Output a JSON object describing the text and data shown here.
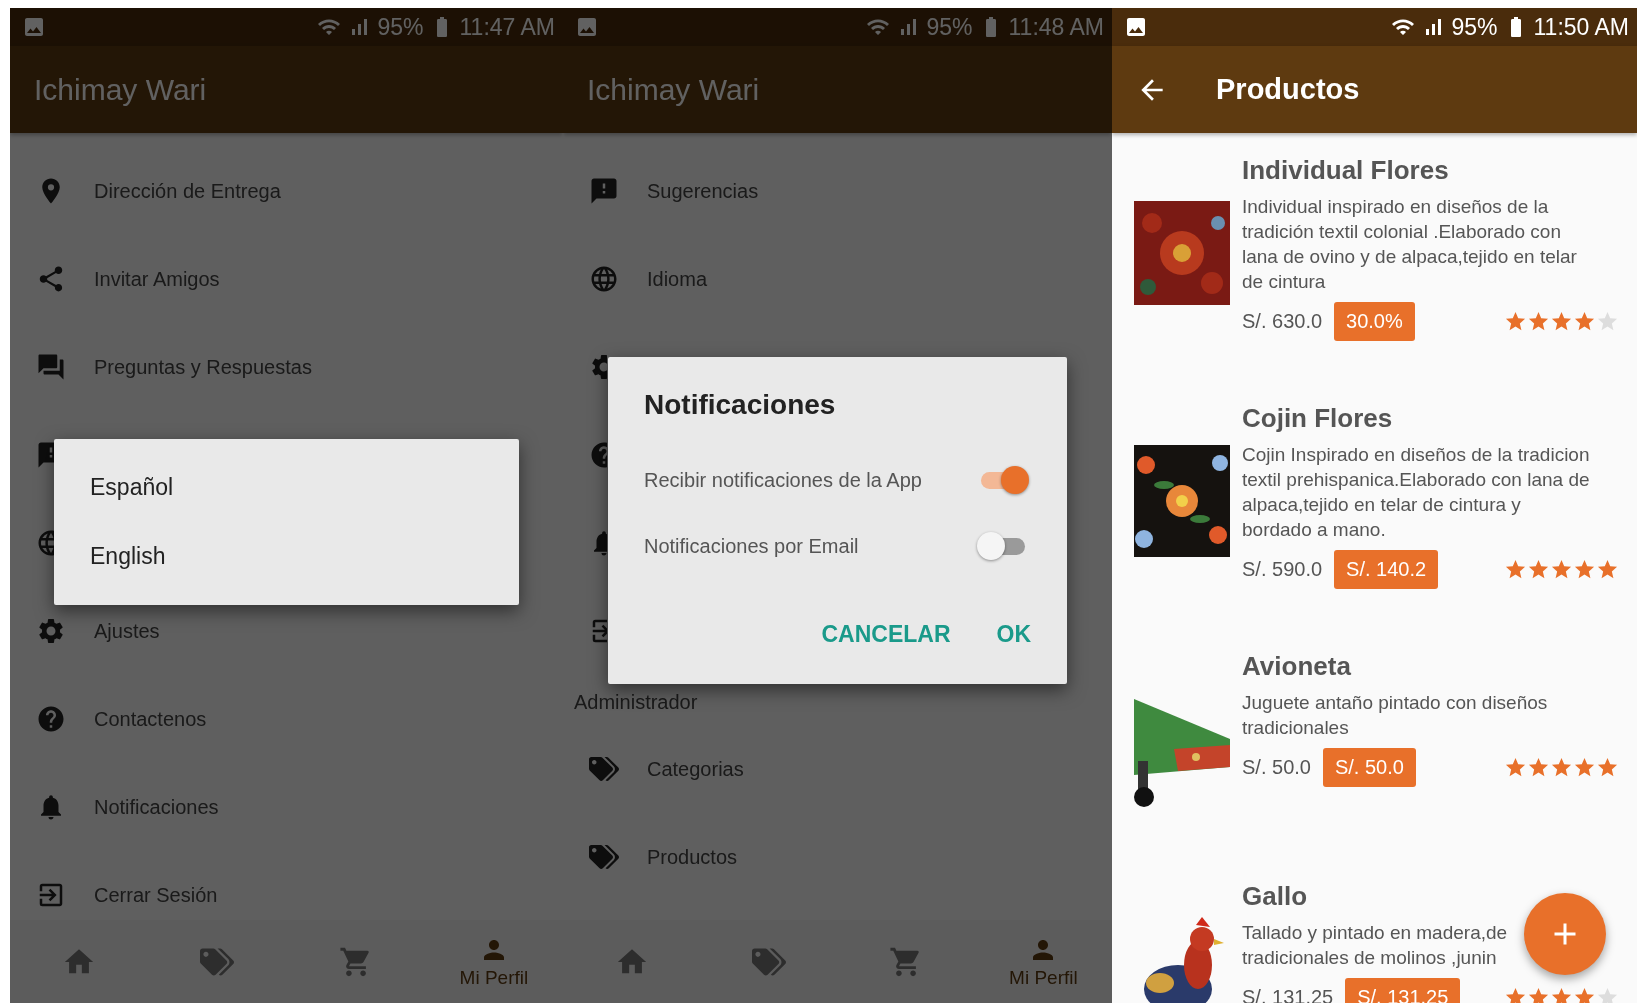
{
  "screens": [
    {
      "kind": "menu",
      "status_bar": {
        "battery": "95%",
        "time": "11:47 AM"
      },
      "app_bar": {
        "title": "Ichimay Wari"
      },
      "menu": [
        {
          "kind": "location",
          "label": "Dirección de Entrega"
        },
        {
          "kind": "share",
          "label": "Invitar Amigos"
        },
        {
          "kind": "faq",
          "label": "Preguntas y Respuestas"
        },
        {
          "kind": "feedback"
        },
        {
          "kind": "globe"
        },
        {
          "kind": "settings",
          "label": "Ajustes"
        },
        {
          "kind": "help",
          "label": "Contactenos"
        },
        {
          "kind": "bell",
          "label": "Notificaciones"
        },
        {
          "kind": "logout",
          "label": "Cerrar Sesión"
        }
      ],
      "bottom_nav": [
        {
          "kind": "home",
          "selected": false
        },
        {
          "kind": "tags",
          "selected": false
        },
        {
          "kind": "cart",
          "selected": false
        },
        {
          "kind": "person",
          "selected": true,
          "label": "Mi Perfil"
        }
      ],
      "dialog": {
        "kind": "choice",
        "options": [
          {
            "label": "Español"
          },
          {
            "label": "English"
          }
        ]
      }
    },
    {
      "kind": "menu",
      "status_bar": {
        "battery": "95%",
        "time": "11:48 AM"
      },
      "app_bar": {
        "title": "Ichimay Wari"
      },
      "menu": [
        {
          "kind": "feedback",
          "label": "Sugerencias"
        },
        {
          "kind": "globe",
          "label": "Idioma"
        },
        {
          "kind": "settings"
        },
        {
          "kind": "help"
        },
        {
          "kind": "bell"
        },
        {
          "kind": "logout"
        },
        {
          "kind": "section",
          "label": "Administrador"
        },
        {
          "kind": "tags",
          "label": "Categorias"
        },
        {
          "kind": "tags",
          "label": "Productos"
        }
      ],
      "bottom_nav": [
        {
          "kind": "home",
          "selected": false
        },
        {
          "kind": "tags",
          "selected": false
        },
        {
          "kind": "cart",
          "selected": false
        },
        {
          "kind": "person",
          "selected": true,
          "label": "Mi Perfil"
        }
      ],
      "dialog": {
        "kind": "switches",
        "title": "Notificaciones",
        "switches": [
          {
            "label": "Recibir notificaciones de la App",
            "on": true
          },
          {
            "label": "Notificaciones por Email",
            "on": false
          }
        ],
        "actions": [
          "CANCELAR",
          "OK"
        ]
      }
    },
    {
      "kind": "products",
      "status_bar": {
        "battery": "95%",
        "time": "11:50 AM"
      },
      "app_bar": {
        "title": "Productos"
      },
      "products": [
        {
          "name": "Individual Flores",
          "description": "Individual inspirado en diseños de la tradición textil colonial .Elaborado con lana de ovino y de alpaca,tejido en telar de cintura",
          "price": "S/. 630.0",
          "badge": "30.0%",
          "stars": 4
        },
        {
          "name": "Cojin Flores",
          "description": "Cojin Inspirado en diseños de la tradicion textil prehispanica.Elaborado con lana de alpaca,tejido en telar de cintura y bordado a mano.",
          "price": "S/. 590.0",
          "badge": "S/. 140.2",
          "stars": 5
        },
        {
          "name": "Avioneta",
          "description": "Juguete antaño pintado con diseños tradicionales",
          "price": "S/. 50.0",
          "badge": "S/. 50.0",
          "stars": 5
        },
        {
          "name": "Gallo",
          "description": "Tallado y pintado en madera,de tradicionales de molinos ,junin",
          "price": "S/. 131.25",
          "badge": "S/. 131.25",
          "stars": 4
        }
      ]
    }
  ]
}
